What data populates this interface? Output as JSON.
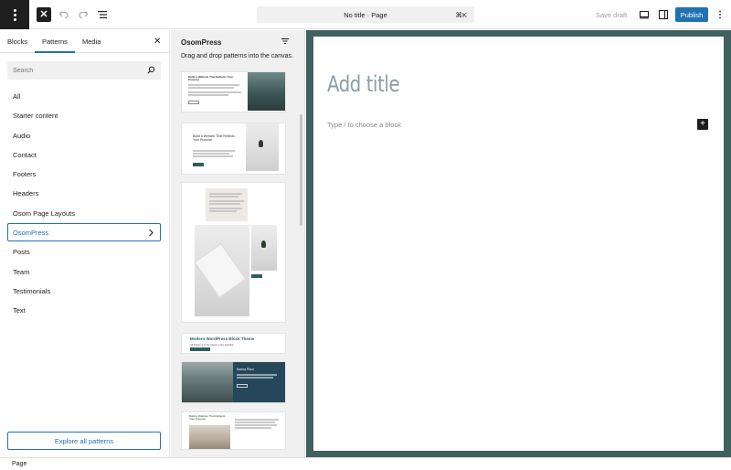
{
  "toolbar": {
    "document_title": "No title · Page",
    "shortcut": "⌘K",
    "save_draft": "Save draft",
    "publish": "Publish",
    "close_icon": "close-icon",
    "undo_icon": "undo-icon",
    "redo_icon": "redo-icon",
    "outline_icon": "list-view-icon"
  },
  "inserter": {
    "tabs": [
      "Blocks",
      "Patterns",
      "Media"
    ],
    "active_tab": "Patterns",
    "search_placeholder": "Search",
    "categories": [
      "All",
      "Starter content",
      "Audio",
      "Contact",
      "Footers",
      "Headers",
      "Osom Page Layouts",
      "OsomPress",
      "Posts",
      "Team",
      "Testimonials",
      "Text"
    ],
    "active_category": "OsomPress",
    "explore_label": "Explore all patterns"
  },
  "patterns": {
    "title": "OsomPress",
    "hint": "Drag and drop patterns into the canvas.",
    "p1_heading": "Build a Website That Reflects Your Purpose",
    "p2_heading": "Build a Website That Reflects Your Purpose",
    "p4_heading": "Modern WordPress Block Theme",
    "p4_sub": "All Patterns & Templates Fully Editable",
    "p5_heading": "Karina Rizzi",
    "p6_heading": "Build a Website That Reflects Your Purpose"
  },
  "canvas": {
    "title_placeholder": "Add title",
    "block_placeholder": "Type / to choose a block",
    "frame_color": "#3f615f"
  },
  "footer": {
    "breadcrumb": "Page"
  },
  "colors": {
    "accent": "#2271b1",
    "dark": "#1e1e1e"
  }
}
